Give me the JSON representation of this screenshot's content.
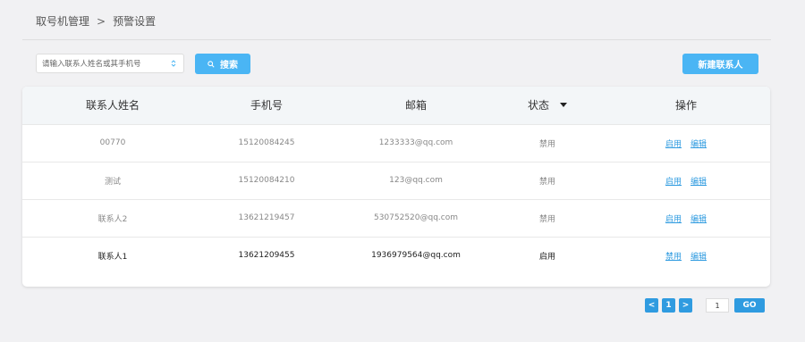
{
  "breadcrumb": {
    "parent": "取号机管理",
    "separator": ">",
    "current": "预警设置"
  },
  "search": {
    "placeholder": "请输入联系人姓名或其手机号",
    "button_label": "搜索"
  },
  "toolbar": {
    "new_contact_label": "新建联系人"
  },
  "table": {
    "columns": [
      "联系人姓名",
      "手机号",
      "邮箱",
      "状态",
      "操作"
    ],
    "rows": [
      {
        "name": "00770",
        "phone": "15120084245",
        "email": "1233333@qq.com",
        "status": "禁用",
        "action1": "启用",
        "action2": "编辑"
      },
      {
        "name": "测试",
        "phone": "15120084210",
        "email": "123@qq.com",
        "status": "禁用",
        "action1": "启用",
        "action2": "编辑"
      },
      {
        "name": "联系人2",
        "phone": "13621219457",
        "email": "530752520@qq.com",
        "status": "禁用",
        "action1": "启用",
        "action2": "编辑"
      },
      {
        "name": "联系人1",
        "phone": "13621209455",
        "email": "1936979564@qq.com",
        "status": "启用",
        "action1": "禁用",
        "action2": "编辑"
      }
    ]
  },
  "pagination": {
    "prev": "<",
    "current_page": "1",
    "next": ">",
    "jump_value": "1",
    "go_label": "GO"
  },
  "colors": {
    "primary": "#4ab5f4",
    "link": "#2f9be0",
    "background": "#f1f1f3"
  }
}
